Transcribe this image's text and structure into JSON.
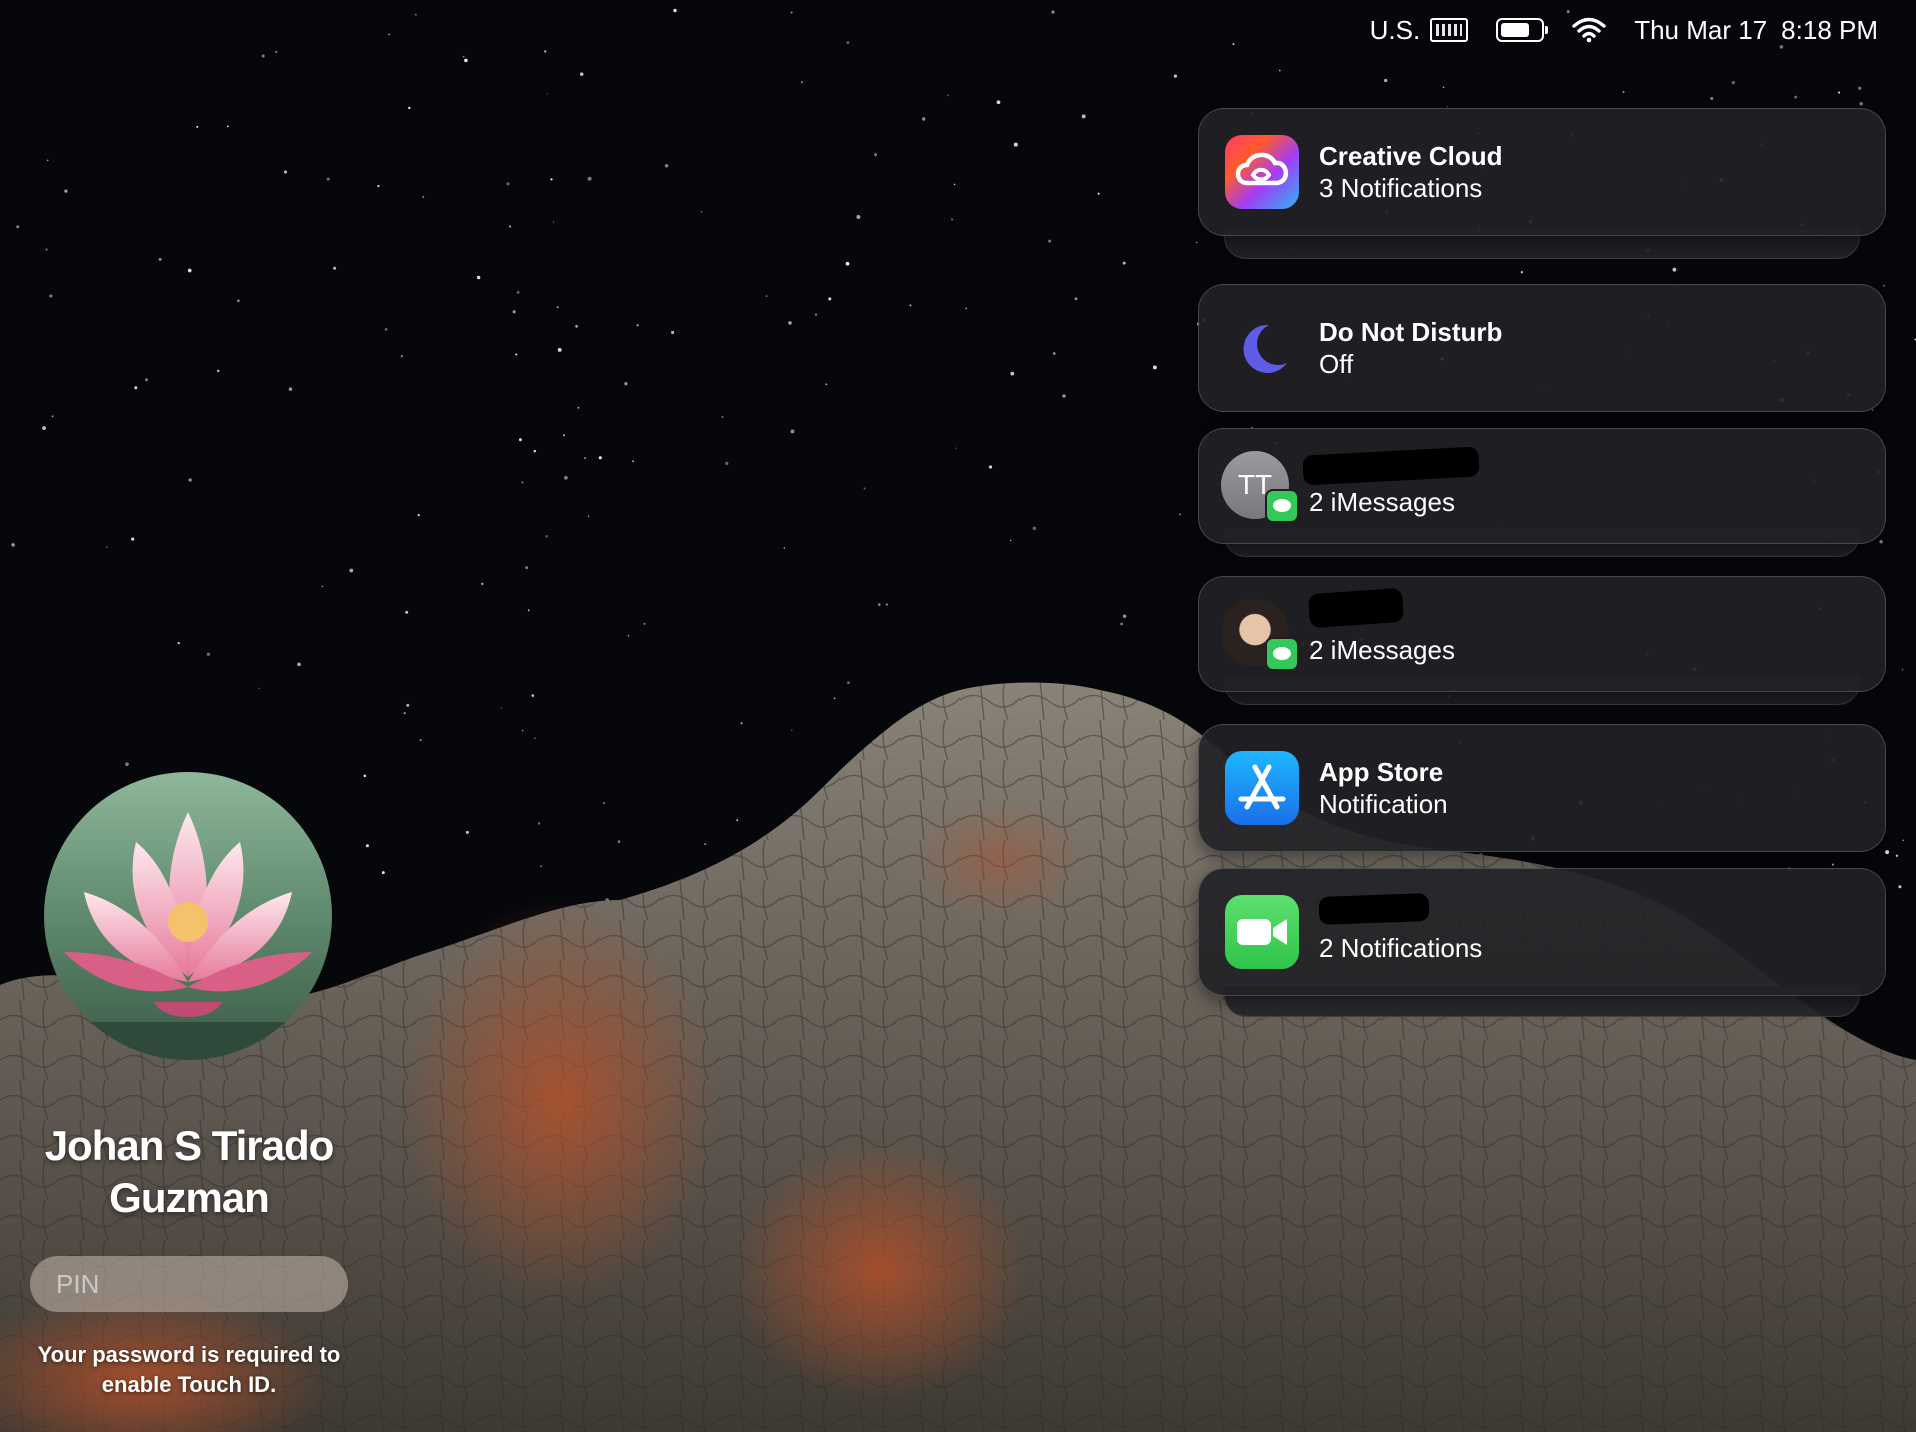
{
  "menubar": {
    "input_source": "U.S.",
    "date": "Thu Mar 17",
    "time": "8:18 PM",
    "battery_level": 0.85
  },
  "notifications": [
    {
      "app": "Creative Cloud",
      "title": "Creative Cloud",
      "subtitle": "3 Notifications",
      "icon": "creative-cloud-icon",
      "stacked": true
    },
    {
      "app": "Do Not Disturb",
      "title": "Do Not Disturb",
      "subtitle": "Off",
      "icon": "moon-icon",
      "stacked": false
    },
    {
      "app": "Messages",
      "avatar_initials": "TT",
      "subtitle": "2 iMessages",
      "icon": "messages-badge-icon",
      "stacked": true
    },
    {
      "app": "Messages",
      "subtitle": "2 iMessages",
      "icon": "messages-badge-icon",
      "stacked": true
    },
    {
      "app": "App Store",
      "title": "App Store",
      "subtitle": "Notification",
      "icon": "app-store-icon",
      "stacked": false
    },
    {
      "app": "FaceTime",
      "subtitle": "2 Notifications",
      "icon": "facetime-icon",
      "stacked": true
    }
  ],
  "login": {
    "user_name": "Johan S Tirado Guzman",
    "pin_placeholder": "PIN",
    "hint": "Your password is required to enable Touch ID."
  },
  "colors": {
    "sky": "#06070b",
    "card_bg": "#222226",
    "dnd_moon": "#5e5ce6",
    "messages_green": "#34c759",
    "app_store_blue": "#1e8ff0",
    "facetime_green": "#3fd25a"
  }
}
